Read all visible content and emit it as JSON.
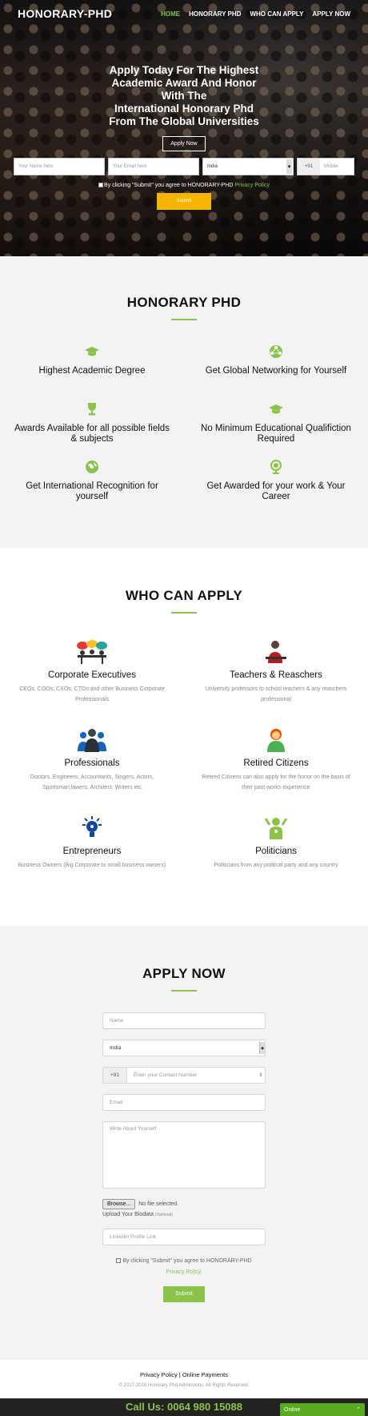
{
  "nav": {
    "logo": "HONORARY-PHD",
    "links": [
      "HOME",
      "HONORARY PHD",
      "WHO CAN APPLY",
      "APPLY NOW"
    ]
  },
  "hero": {
    "title_lines": [
      "Apply Today For The Highest",
      "Academic Award And Honor",
      "With The",
      "International Honorary Phd",
      "From The Global Universities"
    ],
    "apply_button": "Apply Now",
    "name_placeholder": "Your Name here",
    "email_placeholder": "Your Email here",
    "country_value": "India",
    "phone_code": "+91",
    "phone_placeholder": "Mobile",
    "agree_text": "By clicking \"Submit\" you agree to HONORARY-PHD",
    "privacy_link": "Privacy Policy",
    "submit_label": "Submit"
  },
  "honorary": {
    "title": "HONORARY PHD",
    "features": [
      {
        "icon": "graduation-cap-icon",
        "text": "Highest Academic Degree"
      },
      {
        "icon": "globe-network-icon",
        "text": "Get Global Networking for Yourself"
      },
      {
        "icon": "trophy-icon",
        "text": "Awards Available for all possible fields & subjects"
      },
      {
        "icon": "graduation-cap-icon",
        "text": "No Minimum Educational Qualifiction Required"
      },
      {
        "icon": "globe-icon",
        "text": "Get International Recognition for yourself"
      },
      {
        "icon": "globe-stand-icon",
        "text": "Get Awarded for your work & Your Career"
      }
    ]
  },
  "who": {
    "title": "WHO CAN APPLY",
    "items": [
      {
        "icon": "meeting-people-icon",
        "title": "Corporate Executives",
        "desc": "CEOs, COOs, CXOs, CTOs and other Business Corporate Professionals"
      },
      {
        "icon": "teacher-icon",
        "title": "Teachers & Reaschers",
        "desc": "University professors to school teachers & any reaschers professional"
      },
      {
        "icon": "team-icon",
        "title": "Professionals",
        "desc": "Doctors, Engineers, Accountants, Singers, Actors, Sportsman,lawers, Architect, Writers etc"
      },
      {
        "icon": "elderly-person-icon",
        "title": "Retired Citizens",
        "desc": "Retired Citizens can also apply for the honor on the basis of their past works experience"
      },
      {
        "icon": "idea-bulb-icon",
        "title": "Entrepreneurs",
        "desc": "Business Owners (Big Corporate to small business owners)"
      },
      {
        "icon": "politician-icon",
        "title": "Politicians",
        "desc": "Politicians from any political party and any country"
      }
    ]
  },
  "apply": {
    "title": "APPLY NOW",
    "name_placeholder": "Name",
    "country_value": "India",
    "phone_code": "+91",
    "phone_placeholder": "Enter your Contact Number",
    "email_placeholder": "Email",
    "about_placeholder": "Write About Yourself",
    "file_button": "Browse...",
    "file_status": "No file selected.",
    "upload_label": "Upload Your Biodata",
    "upload_optional": "(Optional)",
    "linkedin_placeholder": "Linkedin Profile Link",
    "agree_text": "By clicking \"Submit\" you agree to HONORARY-PHD",
    "privacy_link": "Privacy Policy.",
    "submit_label": "Submit"
  },
  "footer": {
    "privacy": "Privacy Policy",
    "separator": "|",
    "payments": "Online Payments",
    "copyright": "© 2017-2019 Honorary Phd Admissions. All Rights Reserved."
  },
  "callbar": {
    "call_text": "Call Us: 0064 980 15088",
    "online_label": "Online",
    "online_chevron": "chevron-up-icon"
  },
  "colors": {
    "accent_green": "#8bc34a",
    "submit_yellow": "#f5b400",
    "callbar_bg": "#222222"
  }
}
